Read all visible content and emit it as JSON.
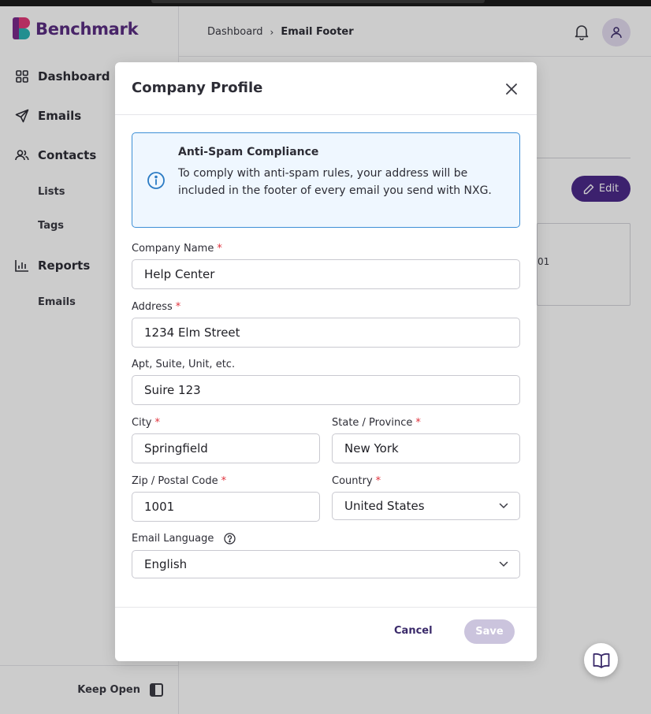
{
  "app": {
    "logo_text": "Benchmark"
  },
  "sidebar": {
    "items": [
      {
        "label": "Dashboard",
        "icon": "grid-icon"
      },
      {
        "label": "Emails",
        "icon": "paper-plane-icon"
      },
      {
        "label": "Contacts",
        "icon": "users-icon"
      },
      {
        "label": "Lists"
      },
      {
        "label": "Tags"
      },
      {
        "label": "Reports",
        "icon": "bar-chart-icon"
      },
      {
        "label": "Emails"
      }
    ],
    "keep_open_label": "Keep Open"
  },
  "header": {
    "breadcrumb": [
      "Dashboard",
      "Email Footer"
    ]
  },
  "background": {
    "edit_label": "Edit",
    "card_fragment": "01"
  },
  "modal": {
    "title": "Company Profile",
    "info": {
      "title": "Anti-Spam Compliance",
      "text": "To comply with anti-spam rules, your address will be included in the footer of every email you send with NXG."
    },
    "fields": {
      "company_name": {
        "label": "Company Name",
        "value": "Help Center",
        "required": true
      },
      "address": {
        "label": "Address",
        "value": "1234 Elm Street",
        "required": true
      },
      "apt": {
        "label": "Apt, Suite, Unit, etc.",
        "value": "Suire 123",
        "required": false
      },
      "city": {
        "label": "City",
        "value": "Springfield",
        "required": true
      },
      "state": {
        "label": "State / Province",
        "value": "New York",
        "required": true
      },
      "zip": {
        "label": "Zip / Postal Code",
        "value": "1001",
        "required": true
      },
      "country": {
        "label": "Country",
        "value": "United States",
        "required": true
      },
      "language": {
        "label": "Email Language",
        "value": "English"
      }
    },
    "required_mark": "*",
    "cancel_label": "Cancel",
    "save_label": "Save"
  },
  "colors": {
    "brand": "#5a2d82",
    "primary_button": "#4b2a8a",
    "info_border": "#3d8fd6",
    "required": "#e0323c"
  }
}
